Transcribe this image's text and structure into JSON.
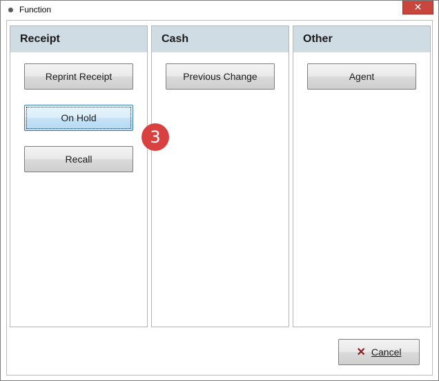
{
  "window": {
    "title": "Function"
  },
  "panels": [
    {
      "title": "Receipt",
      "buttons": [
        "Reprint Receipt",
        "On Hold",
        "Recall"
      ]
    },
    {
      "title": "Cash",
      "buttons": [
        "Previous Change"
      ]
    },
    {
      "title": "Other",
      "buttons": [
        "Agent"
      ]
    }
  ],
  "annotation": {
    "step": "3"
  },
  "footer": {
    "cancel_label": "Cancel",
    "cancel_icon": "x-icon"
  },
  "colors": {
    "header_bg": "#d0dce4",
    "close_button": "#c9463d",
    "badge": "#d94040",
    "cancel_x": "#8b1a1a"
  }
}
